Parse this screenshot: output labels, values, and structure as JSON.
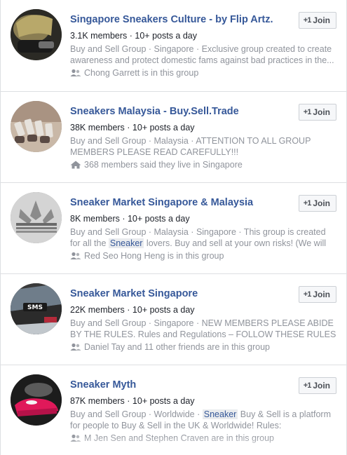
{
  "groups": [
    {
      "title": "Singapore Sneakers Culture - by Flip Artz.",
      "members": "3.1K members · 10+ posts a day",
      "description_parts": [
        "Buy and Sell Group · Singapore · Exclusive group created to create awareness and protect domestic fams against bad practices in the..."
      ],
      "social": "Chong Garrett is in this group",
      "social_icon": "people-icon",
      "join_label": "Join",
      "join_icon": "+1"
    },
    {
      "title": "Sneakers Malaysia - Buy.Sell.Trade",
      "members": "38K members · 10+ posts a day",
      "description_parts": [
        "Buy and Sell Group · Malaysia · ATTENTION TO ALL GROUP MEMBERS PLEASE READ CAREFULLY!!! =========================..."
      ],
      "social": "368 members said they live in Singapore",
      "social_icon": "home-icon",
      "join_label": "Join",
      "join_icon": "+1"
    },
    {
      "title": "Sneaker Market Singapore & Malaysia",
      "members": "8K members · 10+ posts a day",
      "description_before": "Buy and Sell Group · Malaysia · Singapore · This group is created for all the ",
      "description_highlight": "Sneaker",
      "description_after": " lovers. Buy and sell at your own risks! (We will not b...",
      "social": "Red Seo Hong Heng is in this group",
      "social_icon": "people-icon",
      "join_label": "Join",
      "join_icon": "+1"
    },
    {
      "title": "Sneaker Market Singapore",
      "members": "22K members · 10+ posts a day",
      "description_parts": [
        "Buy and Sell Group · Singapore · NEW MEMBERS PLEASE ABIDE BY THE RULES. Rules and Regulations – FOLLOW THESE RULES If you..."
      ],
      "social": "Daniel Tay and 11 other friends are in this group",
      "social_icon": "people-icon",
      "join_label": "Join",
      "join_icon": "+1"
    },
    {
      "title": "Sneaker Myth",
      "members": "87K members · 10+ posts a day",
      "description_before": "Buy and Sell Group · Worldwide · ",
      "description_highlight": "Sneaker",
      "description_after": " Buy & Sell is a platform for people to Buy & Sell in the UK & Worldwide! Rules: http://snkrhd.uk...",
      "social": "M Jen Sen and Stephen Craven are in this group",
      "social_icon": "people-icon",
      "join_label": "Join",
      "join_icon": "+1"
    }
  ],
  "colors": {
    "link": "#365899",
    "muted": "#90949c",
    "text": "#1d2129",
    "border": "#dddfe2"
  }
}
